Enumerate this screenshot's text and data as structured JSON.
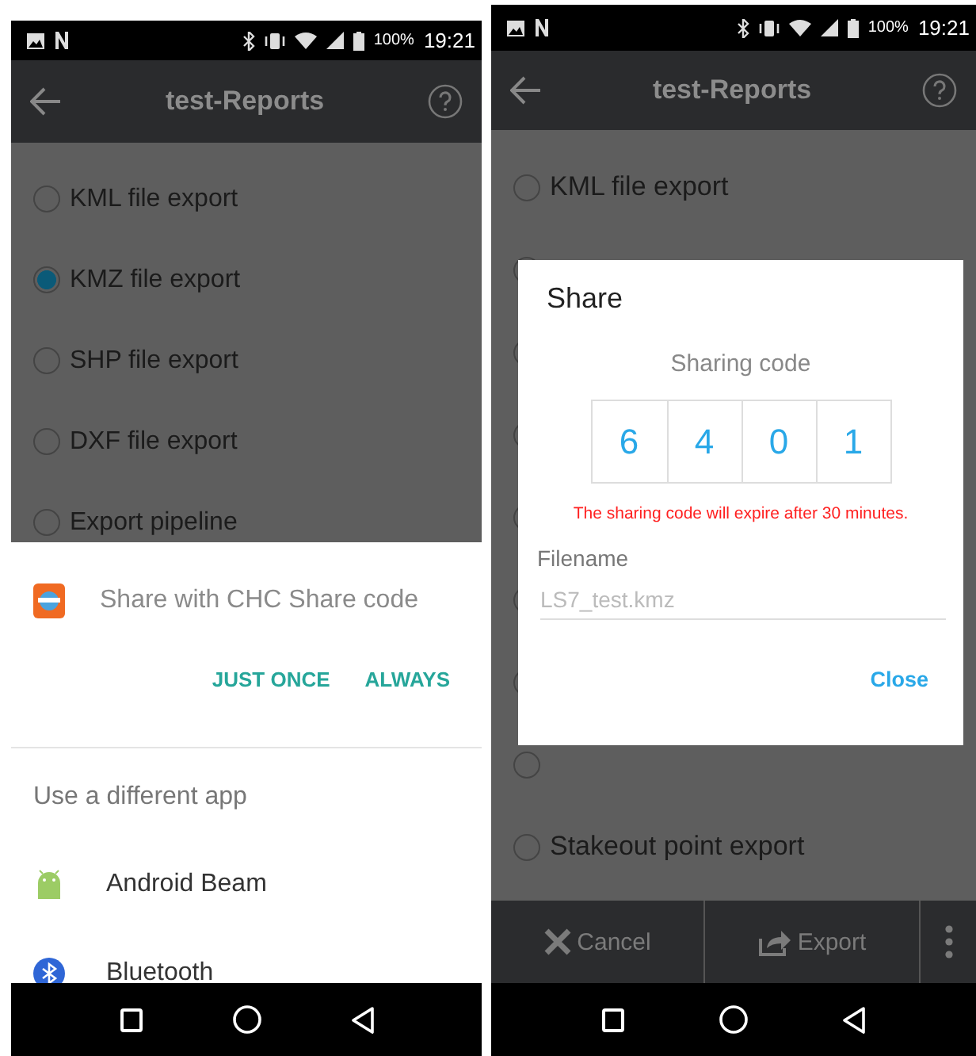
{
  "left_screen": {
    "status_bar": {
      "battery": "100%",
      "time": "19:21"
    },
    "app_bar": {
      "title": "test-Reports"
    },
    "options": [
      {
        "label": "KML file export",
        "selected": false
      },
      {
        "label": "KMZ file export",
        "selected": true
      },
      {
        "label": "SHP file export",
        "selected": false
      },
      {
        "label": "DXF file export",
        "selected": false
      },
      {
        "label": "Export pipeline",
        "selected": false
      }
    ],
    "share_sheet": {
      "default_app": "Share with CHC Share code",
      "buttons": [
        "JUST ONCE",
        "ALWAYS"
      ],
      "section_title": "Use a different app",
      "apps": [
        {
          "kind": "android",
          "label": "Android Beam"
        },
        {
          "kind": "bluetooth",
          "label": "Bluetooth"
        }
      ]
    }
  },
  "right_screen": {
    "status_bar": {
      "battery": "100%",
      "time": "19:21"
    },
    "app_bar": {
      "title": "test-Reports"
    },
    "options": [
      {
        "label": "KML file export",
        "selected": false
      },
      {
        "selected": false
      },
      {
        "selected": false
      },
      {
        "selected": false
      },
      {
        "selected": false
      },
      {
        "selected": false
      },
      {
        "selected": false
      },
      {
        "selected": false
      },
      {
        "label": "Stakeout point export",
        "selected": false
      }
    ],
    "dialog": {
      "title": "Share",
      "code_label": "Sharing code",
      "code_digits": [
        "6",
        "4",
        "0",
        "1"
      ],
      "warning": "The sharing code will expire after 30 minutes.",
      "filename_label": "Filename",
      "filename_placeholder": "LS7_test.kmz",
      "close": "Close"
    },
    "toolbar": {
      "cancel": "Cancel",
      "export": "Export"
    }
  }
}
